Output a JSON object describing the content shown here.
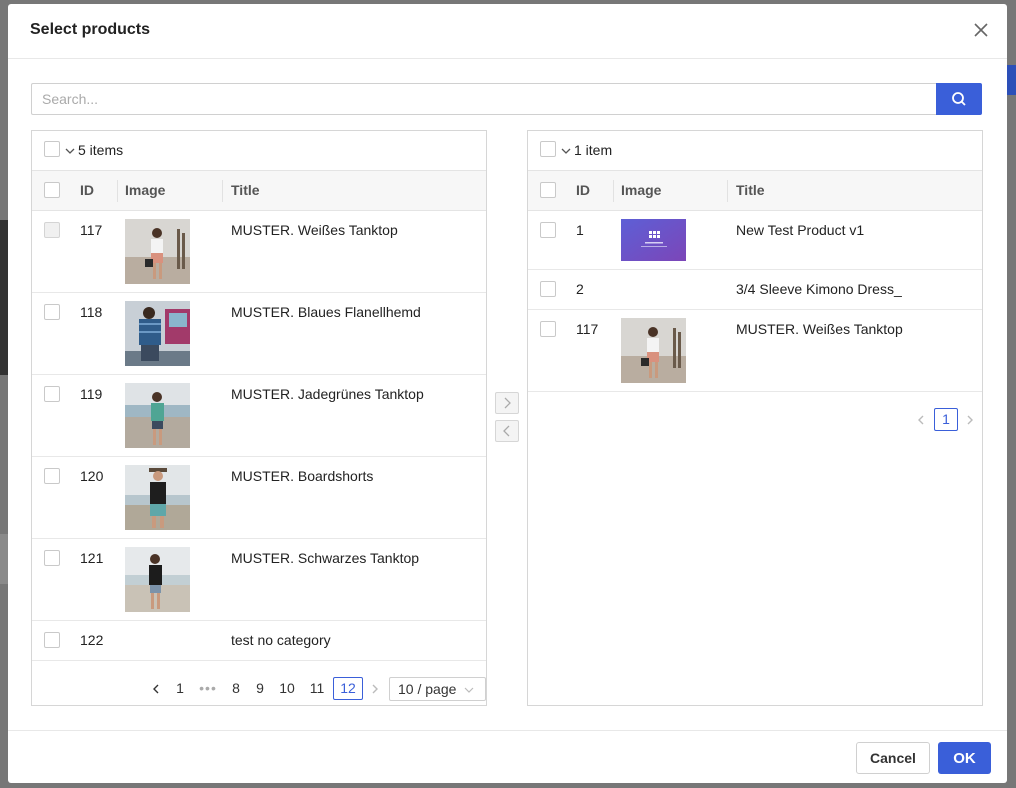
{
  "modal": {
    "title": "Select products"
  },
  "search": {
    "placeholder": "Search..."
  },
  "left_panel": {
    "count": "5 items",
    "headers": {
      "id": "ID",
      "image": "Image",
      "title": "Title"
    },
    "rows": [
      {
        "id": "117",
        "title": "MUSTER. Weißes Tanktop",
        "image": "woman-white-tanktop"
      },
      {
        "id": "118",
        "title": "MUSTER. Blaues Flanellhemd",
        "image": "man-blue-flannel"
      },
      {
        "id": "119",
        "title": "MUSTER. Jadegrünes Tanktop",
        "image": "woman-jade-tanktop"
      },
      {
        "id": "120",
        "title": "MUSTER. Boardshorts",
        "image": "man-boardshorts"
      },
      {
        "id": "121",
        "title": "MUSTER. Schwarzes Tanktop",
        "image": "woman-black-tanktop"
      },
      {
        "id": "122",
        "title": "test no category",
        "image": ""
      }
    ],
    "pagination": {
      "pages": [
        "1",
        "8",
        "9",
        "10",
        "11",
        "12"
      ],
      "ellipsis": "•••",
      "current": "12",
      "page_size": "10 / page"
    }
  },
  "right_panel": {
    "count": "1 item",
    "headers": {
      "id": "ID",
      "image": "Image",
      "title": "Title"
    },
    "rows": [
      {
        "id": "1",
        "title": "New Test Product v1",
        "image": "purple-banner"
      },
      {
        "id": "2",
        "title": "3/4 Sleeve Kimono Dress_",
        "image": ""
      },
      {
        "id": "117",
        "title": "MUSTER. Weißes Tanktop",
        "image": "woman-white-tanktop"
      }
    ],
    "pagination": {
      "pages": [
        "1"
      ],
      "current": "1"
    }
  },
  "footer": {
    "cancel_label": "Cancel",
    "ok_label": "OK"
  },
  "colors": {
    "primary": "#3a5fd9",
    "border": "#d6d6d6",
    "header_bg": "#f7f7f7"
  },
  "icons": {
    "close": "close-icon",
    "search": "search-icon",
    "move_right": "chevron-right-icon",
    "move_left": "chevron-left-icon"
  }
}
